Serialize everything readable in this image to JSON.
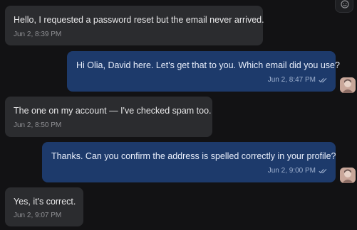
{
  "messages": [
    {
      "direction": "incoming",
      "text": "Hello, I requested a password reset but the email never arrived.",
      "time": "Jun 2, 8:39 PM"
    },
    {
      "direction": "outgoing",
      "text": "Hi Olia, David here. Let's get that to you. Which email did you use?",
      "time": "Jun 2, 8:47 PM",
      "status_icon": "double-check-icon"
    },
    {
      "direction": "incoming",
      "text": "The one on my account — I've checked spam too.",
      "time": "Jun 2, 8:50 PM"
    },
    {
      "direction": "outgoing",
      "text": "Thanks. Can you confirm the address is spelled correctly in your profile?",
      "time": "Jun 2, 9:00 PM",
      "status_icon": "double-check-icon"
    },
    {
      "direction": "incoming",
      "text": "Yes, it's correct.",
      "time": "Jun 2, 9:07 PM"
    }
  ],
  "icons": {
    "top_action": "emoji-reaction-icon",
    "agent_avatar": "agent-avatar"
  },
  "colors": {
    "background": "#121214",
    "incoming_bubble": "#2b2c2f",
    "outgoing_bubble": "#1d3a6b"
  }
}
